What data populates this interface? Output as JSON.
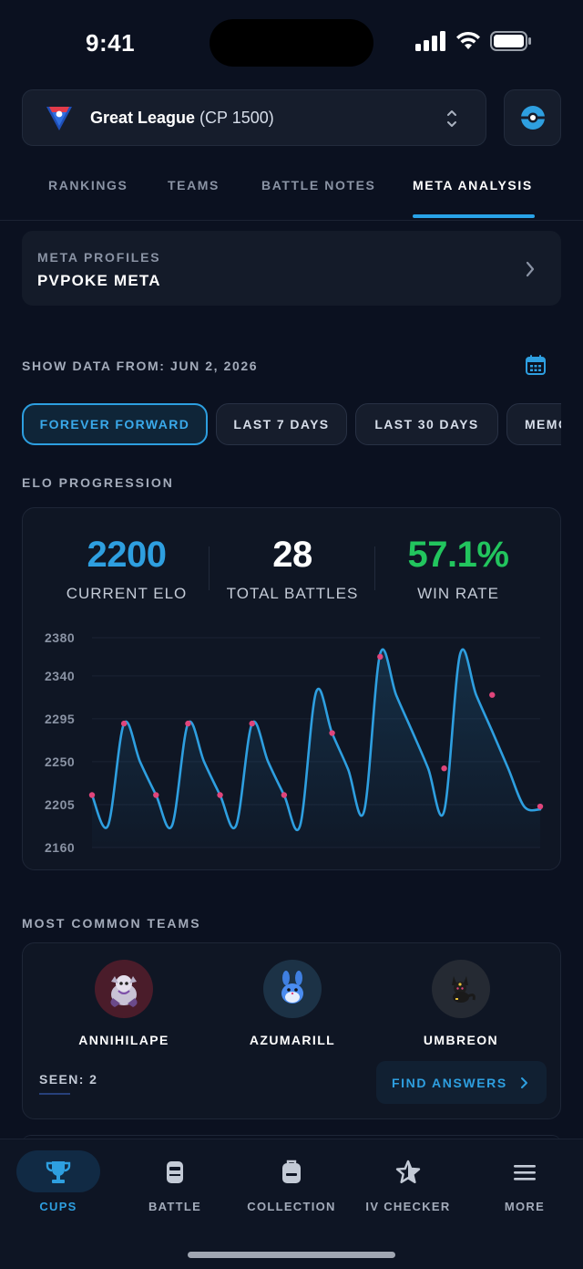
{
  "status_bar": {
    "time": "9:41"
  },
  "league": {
    "name": "Great League",
    "cp": "(CP 1500)"
  },
  "tabs": [
    {
      "label": "RANKINGS",
      "active": false
    },
    {
      "label": "TEAMS",
      "active": false
    },
    {
      "label": "BATTLE NOTES",
      "active": false
    },
    {
      "label": "META ANALYSIS",
      "active": true
    }
  ],
  "meta_profile": {
    "label": "META PROFILES",
    "value": "PVPOKE META"
  },
  "show_data": {
    "label": "SHOW DATA FROM: JUN 2, 2026"
  },
  "filters": [
    {
      "label": "FOREVER FORWARD",
      "active": true
    },
    {
      "label": "LAST 7 DAYS",
      "active": false
    },
    {
      "label": "LAST 30 DAYS",
      "active": false
    },
    {
      "label": "MEMO",
      "active": false
    }
  ],
  "elo": {
    "section_title": "ELO PROGRESSION",
    "stats": {
      "current": {
        "value": "2200",
        "label": "CURRENT ELO",
        "color": "#2e9fe0"
      },
      "battles": {
        "value": "28",
        "label": "TOTAL BATTLES",
        "color": "#ffffff"
      },
      "win_rate": {
        "value": "57.1%",
        "label": "WIN RATE",
        "color": "#22c55e"
      }
    }
  },
  "chart_data": {
    "type": "line",
    "yticks": [
      2380,
      2340,
      2295,
      2250,
      2205,
      2160
    ],
    "ylim": [
      2160,
      2380
    ],
    "x": [
      0,
      1,
      2,
      3,
      4,
      5,
      6,
      7,
      8,
      9,
      10,
      11,
      12,
      13,
      14,
      15,
      16,
      17,
      18,
      19,
      20,
      21,
      22,
      23,
      24,
      25,
      26,
      27,
      28
    ],
    "values": [
      2215,
      2183,
      2290,
      2250,
      2215,
      2183,
      2290,
      2250,
      2215,
      2183,
      2290,
      2250,
      2215,
      2183,
      2323,
      2280,
      2242,
      2198,
      2363,
      2320,
      2282,
      2243,
      2198,
      2363,
      2320,
      2282,
      2243,
      2203,
      2200
    ],
    "markers": [
      {
        "x": 0,
        "value": 2215
      },
      {
        "x": 2,
        "value": 2290
      },
      {
        "x": 4,
        "value": 2215
      },
      {
        "x": 6,
        "value": 2290
      },
      {
        "x": 8,
        "value": 2215
      },
      {
        "x": 10,
        "value": 2290
      },
      {
        "x": 12,
        "value": 2215
      },
      {
        "x": 15,
        "value": 2280
      },
      {
        "x": 18,
        "value": 2360
      },
      {
        "x": 22,
        "value": 2243
      },
      {
        "x": 25,
        "value": 2320
      },
      {
        "x": 28,
        "value": 2203
      }
    ],
    "line_color": "#2e9fe0",
    "marker_color": "#e0457b",
    "grid": true
  },
  "teams": {
    "section_title": "MOST COMMON TEAMS",
    "members": [
      {
        "name": "ANNIHILAPE",
        "icon": "annihilape-sprite",
        "bg": "#4a1c2a"
      },
      {
        "name": "AZUMARILL",
        "icon": "azumarill-sprite",
        "bg": "#1c3246"
      },
      {
        "name": "UMBREON",
        "icon": "umbreon-sprite",
        "bg": "#252a33"
      }
    ],
    "seen": "SEEN: 2",
    "find_answers": "FIND ANSWERS"
  },
  "bottom_nav": [
    {
      "label": "CUPS",
      "icon": "trophy-icon",
      "active": true
    },
    {
      "label": "BATTLE",
      "icon": "battle-icon",
      "active": false
    },
    {
      "label": "COLLECTION",
      "icon": "backpack-icon",
      "active": false
    },
    {
      "label": "IV CHECKER",
      "icon": "star-icon",
      "active": false
    },
    {
      "label": "MORE",
      "icon": "menu-icon",
      "active": false
    }
  ]
}
